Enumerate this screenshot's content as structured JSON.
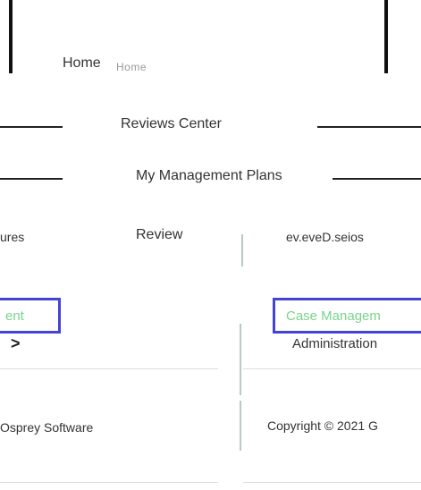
{
  "nav": {
    "home": "Home",
    "home_ghost": "Home",
    "reviews_center": "Reviews Center",
    "my_management_plans": "My Management Plans",
    "review": "Review",
    "left_fragment": "ures",
    "right_fragment": "ev.eveD.seios"
  },
  "menu": {
    "left_selected": "ent",
    "right_selected": "Case Managem",
    "left_chevron": ">",
    "administration": "Administration"
  },
  "footer": {
    "left": "Osprey Software",
    "right": "Copyright © 2021 G"
  },
  "colors": {
    "selection_border": "#4343d6",
    "selected_text": "#7bd38b",
    "divider": "#b9c9c5"
  }
}
